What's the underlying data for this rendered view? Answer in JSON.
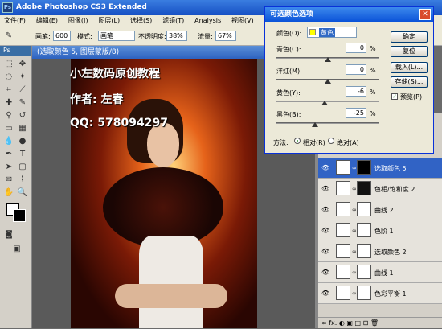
{
  "app": {
    "title": "Adobe Photoshop CS3 Extended",
    "logo": "Ps"
  },
  "menu": [
    "文件(F)",
    "编辑(E)",
    "图像(I)",
    "图层(L)",
    "选择(S)",
    "滤镜(T)",
    "Analysis",
    "视图(V)"
  ],
  "options": {
    "brush_label": "画笔:",
    "brush_size": "600",
    "mode_label": "模式:",
    "mode_value": "画笔",
    "opacity_label": "不透明度:",
    "opacity_value": "38%",
    "flow_label": "流量:",
    "flow_value": "67%"
  },
  "canvas": {
    "title": "(选取颜色 5, 图层蒙版/8)",
    "overlay_line1": "小左数码原创教程",
    "overlay_line2": "作者: 左春",
    "overlay_line3": "QQ: 578094297"
  },
  "dialog": {
    "title": "可选颜色选项",
    "color_label": "颜色(O):",
    "color_value": "黄色",
    "rows": [
      {
        "label": "青色(C):",
        "value": "0",
        "unit": "%"
      },
      {
        "label": "洋红(M):",
        "value": "0",
        "unit": "%"
      },
      {
        "label": "黄色(Y):",
        "value": "-6",
        "unit": "%"
      },
      {
        "label": "黑色(B):",
        "value": "-25",
        "unit": "%"
      }
    ],
    "method_label": "方法:",
    "relative": "相对(R)",
    "absolute": "绝对(A)",
    "ok": "确定",
    "reset": "复位",
    "load": "载入(L)...",
    "save": "存储(S)...",
    "preview": "预览(P)"
  },
  "layers": [
    {
      "name": "选取颜色 5",
      "selected": true
    },
    {
      "name": "色相/饱和度 2",
      "selected": false
    },
    {
      "name": "曲线 2",
      "selected": false
    },
    {
      "name": "色阶 1",
      "selected": false
    },
    {
      "name": "选取颜色 2",
      "selected": false
    },
    {
      "name": "曲线 1",
      "selected": false
    },
    {
      "name": "色彩平衡 1",
      "selected": false
    }
  ],
  "layers_footer": "∞ fx. ◐ ▣ ◫ ⊡ 🗑"
}
